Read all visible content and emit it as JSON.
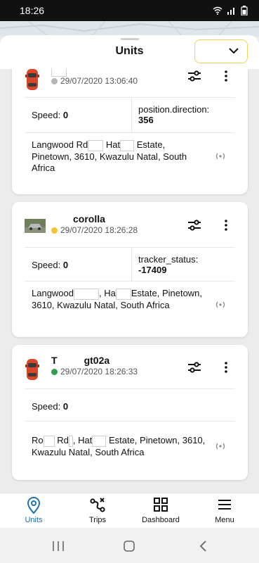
{
  "status_bar": {
    "time": "18:26"
  },
  "header": {
    "title": "Units",
    "dropdown_value": ""
  },
  "units": [
    {
      "name": "",
      "status_color": "#b5b5b5",
      "timestamp": "29/07/2020 13:06:40",
      "speed_label": "Speed:",
      "speed_value": "0",
      "extra_label": "position.direction:",
      "extra_value": "356",
      "address_parts": [
        "Langwood Rd",
        "Hat",
        " Estate,",
        "Pinetown, 3610, Kwazulu Natal, South Africa"
      ],
      "thumb": "car-icon"
    },
    {
      "name": "corolla",
      "status_color": "#f4c430",
      "timestamp": "29/07/2020 18:26:28",
      "speed_label": "Speed:",
      "speed_value": "0",
      "extra_label": "tracker_status:",
      "extra_value": "-17409",
      "address_parts": [
        "Langwood",
        ", Ha",
        "Estate,",
        "Pinetown, 3610, Kwazulu Natal, South Africa"
      ],
      "thumb": "car-photo"
    },
    {
      "name_prefix": "T",
      "name_suffix": "gt02a",
      "status_color": "#2e9e4f",
      "timestamp": "29/07/2020 18:26:33",
      "speed_label": "Speed:",
      "speed_value": "0",
      "address_parts": [
        "Ro",
        " Rd",
        ", Hat",
        " Estate, Pinetown,",
        "3610, Kwazulu Natal, South Africa"
      ],
      "thumb": "car-icon"
    }
  ],
  "bottom_nav": {
    "items": [
      {
        "label": "Units",
        "icon": "location-pin-icon",
        "active": true
      },
      {
        "label": "Trips",
        "icon": "route-icon",
        "active": false
      },
      {
        "label": "Dashboard",
        "icon": "grid-icon",
        "active": false
      },
      {
        "label": "Menu",
        "icon": "hamburger-icon",
        "active": false
      }
    ]
  },
  "colors": {
    "accent": "#1f6fb5",
    "dropdown_border": "#f2d35a"
  }
}
